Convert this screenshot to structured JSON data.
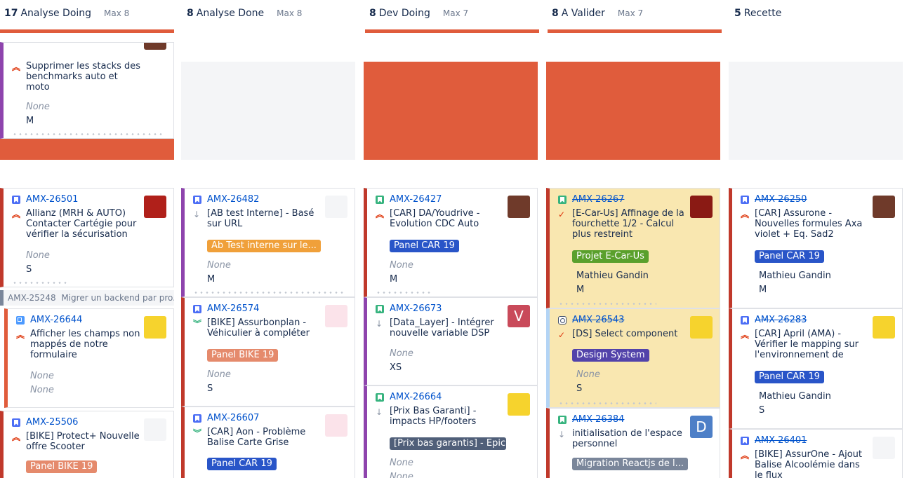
{
  "columns": [
    {
      "count": "17",
      "name": "Analyse Doing",
      "max": "Max 8"
    },
    {
      "count": "8",
      "name": "Analyse Done",
      "max": "Max 8"
    },
    {
      "count": "8",
      "name": "Dev Doing",
      "max": "Max 7"
    },
    {
      "count": "8",
      "name": "A Valider",
      "max": "Max 7"
    },
    {
      "count": "5",
      "name": "Recette",
      "max": ""
    }
  ],
  "top_card": {
    "summary": "Supprimer les stacks des benchmarks auto et moto",
    "field1": "None",
    "field2": "M"
  },
  "parent_strip": {
    "key": "AMX-25248",
    "text": "Migrer un backend par pro..."
  },
  "cards": {
    "c1a": {
      "key": "AMX-26501",
      "summary": "Allianz (MRH & AUTO) Contacter Cartégie pour vérifier la sécurisation",
      "field1": "None",
      "field2": "S"
    },
    "c1b": {
      "key": "AMX-26644",
      "summary": "Afficher les champs non mappés de notre formulaire",
      "field1": "None",
      "field2": "None"
    },
    "c1c": {
      "key": "AMX-25506",
      "summary": "[BIKE] Protect+ Nouvelle offre Scooter",
      "label": "Panel BIKE 19"
    },
    "c2a": {
      "key": "AMX-26482",
      "summary": "[AB test Interne] - Basé sur URL",
      "label": "Ab Test interne sur le...",
      "field1": "None",
      "field2": "M"
    },
    "c2b": {
      "key": "AMX-26574",
      "summary": "[BIKE] Assurbonplan - Véhiculier à compléter",
      "label": "Panel BIKE 19",
      "field1": "None",
      "field2": "S"
    },
    "c2c": {
      "key": "AMX-26607",
      "summary": "[CAR] Aon - Problème Balise Carte Grise",
      "label": "Panel CAR 19"
    },
    "c3a": {
      "key": "AMX-26427",
      "summary": "[CAR] DA/Youdrive - Evolution CDC Auto",
      "label": "Panel CAR 19",
      "field1": "None",
      "field2": "M"
    },
    "c3b": {
      "key": "AMX-26673",
      "summary": "[Data_Layer] - Intégrer nouvelle variable DSP",
      "field1": "None",
      "field2": "XS",
      "avatar": "V"
    },
    "c3c": {
      "key": "AMX-26664",
      "summary": "[Prix Bas Garanti] - impacts HP/footers",
      "label": "[Prix bas garantis] - Epic",
      "field1": "None",
      "field2": "None"
    },
    "c4a": {
      "key": "AMX-26267",
      "summary": "[E-Car-Us] Affinage de la fourchette 1/2 - Calcul plus restreint",
      "label": "Projet E-Car-Us",
      "field1": "Mathieu Gandin",
      "field2": "M"
    },
    "c4b": {
      "key": "AMX-26543",
      "summary": "[DS] Select component",
      "label": "Design System",
      "field1": "None",
      "field2": "S"
    },
    "c4c": {
      "key": "AMX-26384",
      "summary": "initialisation de l'espace personnel",
      "label": "Migration Reactjs de l...",
      "avatar": "D"
    },
    "c5a": {
      "key": "AMX-26250",
      "summary": "[CAR] Assurone - Nouvelles formules Axa violet + Eq. Sad2",
      "label": "Panel CAR 19",
      "field1": "Mathieu Gandin",
      "field2": "M"
    },
    "c5b": {
      "key": "AMX-26283",
      "summary": "[CAR] April (AMA) - Vérifier le mapping sur l'environnement de",
      "label": "Panel CAR 19",
      "field1": "Mathieu Gandin",
      "field2": "S"
    },
    "c5c": {
      "key": "AMX-26401",
      "summary": "[BIKE] AssurOne - Ajout Balise Alcoolémie dans le flux"
    }
  },
  "colors": {
    "accent": "#e05c3c",
    "link": "#0052cc",
    "card_done_bg": "#f9e7b0"
  }
}
